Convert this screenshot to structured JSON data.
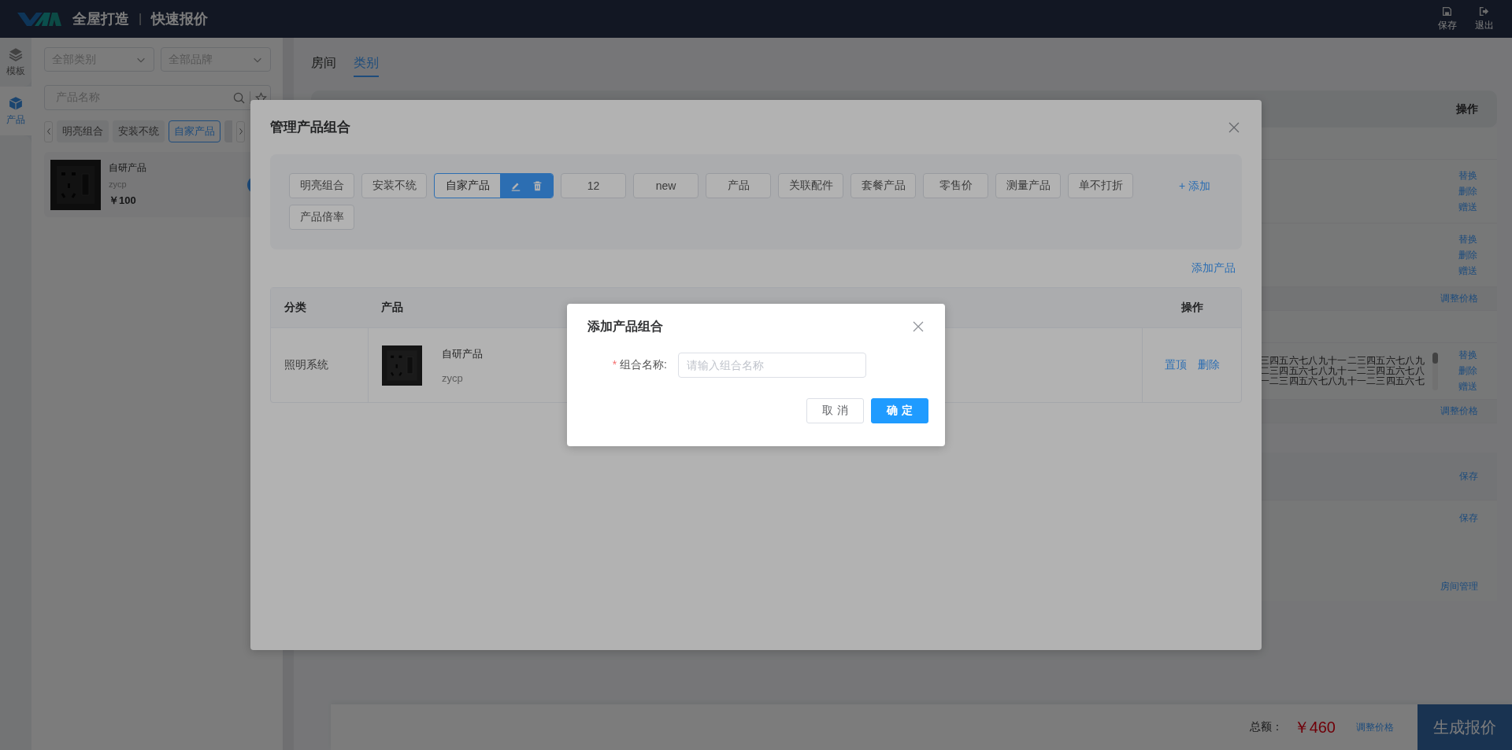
{
  "header": {
    "title": "全屋打造",
    "separator": "|",
    "subtitle": "快速报价",
    "actions": [
      {
        "label": "保存"
      },
      {
        "label": "退出"
      }
    ]
  },
  "nav_rail": [
    {
      "label": "模板",
      "selected": false
    },
    {
      "label": "产品",
      "selected": true
    }
  ],
  "product_panel": {
    "filters": [
      {
        "placeholder": "全部类别"
      },
      {
        "placeholder": "全部品牌"
      }
    ],
    "search": {
      "placeholder": "产品名称"
    },
    "groups": [
      {
        "label": "明亮组合",
        "selected": false
      },
      {
        "label": "安装不统",
        "selected": false
      },
      {
        "label": "自家产品",
        "selected": true
      }
    ],
    "products": [
      {
        "name": "自研产品",
        "code": "zycp",
        "price": "￥100"
      }
    ]
  },
  "main": {
    "tabs": [
      {
        "label": "房间",
        "selected": false
      },
      {
        "label": "类别",
        "selected": true
      }
    ],
    "table": {
      "action_header": "操作",
      "rows": [
        {
          "kind": "blank"
        },
        {
          "kind": "item",
          "actions": [
            "替换",
            "删除",
            "赠送"
          ]
        },
        {
          "kind": "item",
          "actions": [
            "替换",
            "删除",
            "赠送"
          ]
        },
        {
          "kind": "subtotal",
          "actions": [
            "调整价格"
          ]
        },
        {
          "kind": "blank"
        },
        {
          "kind": "item",
          "text_lines": [
            "三四五六七八九十一二三四五六七八九",
            "二三四五六七八九十一二三四五六七八",
            "一二三四五六七八九十一二三四五六七"
          ],
          "actions": [
            "替换",
            "删除",
            "赠送"
          ]
        },
        {
          "kind": "subtotal",
          "actions": [
            "调整价格"
          ]
        },
        {
          "kind": "section",
          "actions": [
            "保存"
          ]
        },
        {
          "kind": "room",
          "actions": [
            "保存"
          ],
          "manage": "房间管理"
        }
      ]
    },
    "footer": {
      "total_label": "总额：",
      "total": "￥460",
      "adjust": "调整价格",
      "generate": "生成报价"
    }
  },
  "modal": {
    "title": "管理产品组合",
    "groups": [
      {
        "label": "明亮组合",
        "selected": false
      },
      {
        "label": "安装不统",
        "selected": false
      },
      {
        "label": "自家产品",
        "selected": true
      },
      {
        "label": "12",
        "selected": false
      },
      {
        "label": "new",
        "selected": false
      },
      {
        "label": "产品",
        "selected": false
      },
      {
        "label": "关联配件",
        "selected": false
      },
      {
        "label": "套餐产品",
        "selected": false
      },
      {
        "label": "零售价",
        "selected": false
      },
      {
        "label": "测量产品",
        "selected": false
      },
      {
        "label": "单不打折",
        "selected": false
      },
      {
        "label": "产品倍率",
        "selected": false
      }
    ],
    "add_group": "+ 添加",
    "add_product": "添加产品",
    "table": {
      "columns": [
        "分类",
        "产品"
      ],
      "action_column": "操作",
      "rows": [
        {
          "category": "照明系统",
          "name": "自研产品",
          "code": "zycp",
          "actions": [
            "置顶",
            "删除"
          ]
        }
      ]
    }
  },
  "dialog": {
    "title": "添加产品组合",
    "field": {
      "required_mark": "*",
      "label": "组合名称:",
      "placeholder": "请输入组合名称"
    },
    "buttons": [
      {
        "label": "取消",
        "kind": "default"
      },
      {
        "label": "确定",
        "kind": "primary"
      }
    ]
  }
}
